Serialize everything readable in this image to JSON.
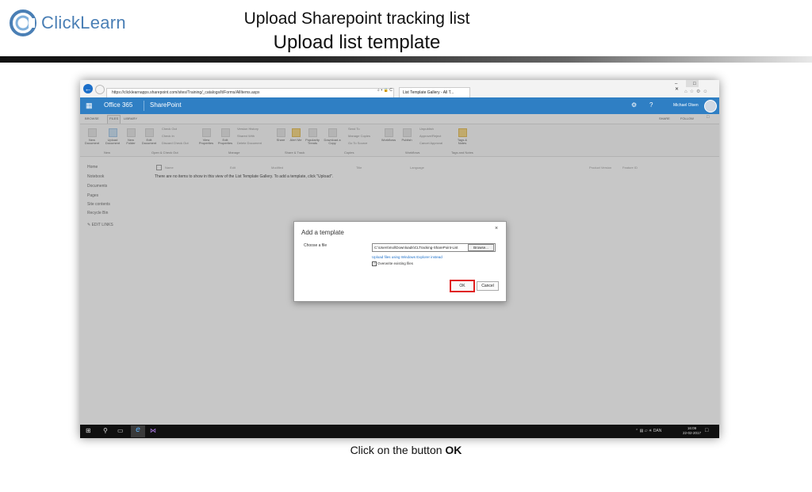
{
  "slide": {
    "brand": "ClickLearn",
    "title": "Upload Sharepoint tracking list",
    "subtitle": "Upload list template",
    "instruction_prefix": "Click on the button ",
    "instruction_target": "OK"
  },
  "browser": {
    "url": "https://clicklearnapps.sharepoint.com/sites/Training/_catalogs/lt/Forms/AllItems.aspx",
    "address_tools": "⌕ ▾ 🔒 C",
    "tab_title": "List Template Gallery - All T...",
    "window_controls": "– □ ✕"
  },
  "suite_bar": {
    "app": "Office 365",
    "site": "SharePoint",
    "user": "Michael Olsen"
  },
  "ribbon_tabs": [
    "BROWSE",
    "FILES",
    "LIBRARY"
  ],
  "ribbon_actions": {
    "share": "SHARE",
    "follow": "FOLLOW"
  },
  "ribbon": {
    "new_doc": "New Document",
    "upload_doc": "Upload Document",
    "new_folder": "New Folder",
    "edit_doc": "Edit Document",
    "check_out": "Check Out",
    "check_in": "Check In",
    "discard_check_out": "Discard Check Out",
    "view_props": "View Properties",
    "edit_props": "Edit Properties",
    "version_history": "Version History",
    "shared_with": "Shared With",
    "delete_doc": "Delete Document",
    "share": "Share",
    "alert_me": "Alert Me",
    "popularity_trends": "Popularity Trends",
    "download_copy": "Download a Copy",
    "send_to": "Send To",
    "manage_copies": "Manage Copies",
    "go_to_source": "Go To Source",
    "workflows": "Workflows",
    "publish": "Publish",
    "unpublish": "Unpublish",
    "approve_reject": "Approve/Reject",
    "cancel_approval": "Cancel Approval",
    "tags_notes": "Tags & Notes",
    "groups": {
      "new": "New",
      "open_check_out": "Open & Check Out",
      "manage": "Manage",
      "share_track": "Share & Track",
      "copies": "Copies",
      "workflows": "Workflows",
      "tags_notes": "Tags and Notes"
    }
  },
  "left_nav": [
    "Home",
    "Notebook",
    "Documents",
    "Pages",
    "Site contents",
    "Recycle Bin"
  ],
  "edit_links": "EDIT LINKS",
  "list_headers": [
    "Name",
    "Edit",
    "Modified",
    "Title",
    "Language",
    "Product Version",
    "Feature ID"
  ],
  "empty_message": "There are no items to show in this view of the List Template Gallery. To add a template, click \"Upload\".",
  "dialog": {
    "title": "Add a template",
    "close": "×",
    "choose_file_label": "Choose a file",
    "file_path": "C:\\Users\\mol\\Downloads\\CLTracking-SharePoint-List",
    "browse": "Browse...",
    "explorer_link": "Upload files using Windows Explorer instead",
    "overwrite_label": "Overwrite existing files",
    "overwrite_checked": true,
    "ok": "OK",
    "cancel": "Cancel"
  },
  "taskbar": {
    "language": "DAN",
    "time": "16:09",
    "date": "22-02-2017"
  },
  "colors": {
    "suite_blue": "#2f7fc4",
    "highlight_red": "#e02020",
    "link_blue": "#1c6fc9"
  }
}
